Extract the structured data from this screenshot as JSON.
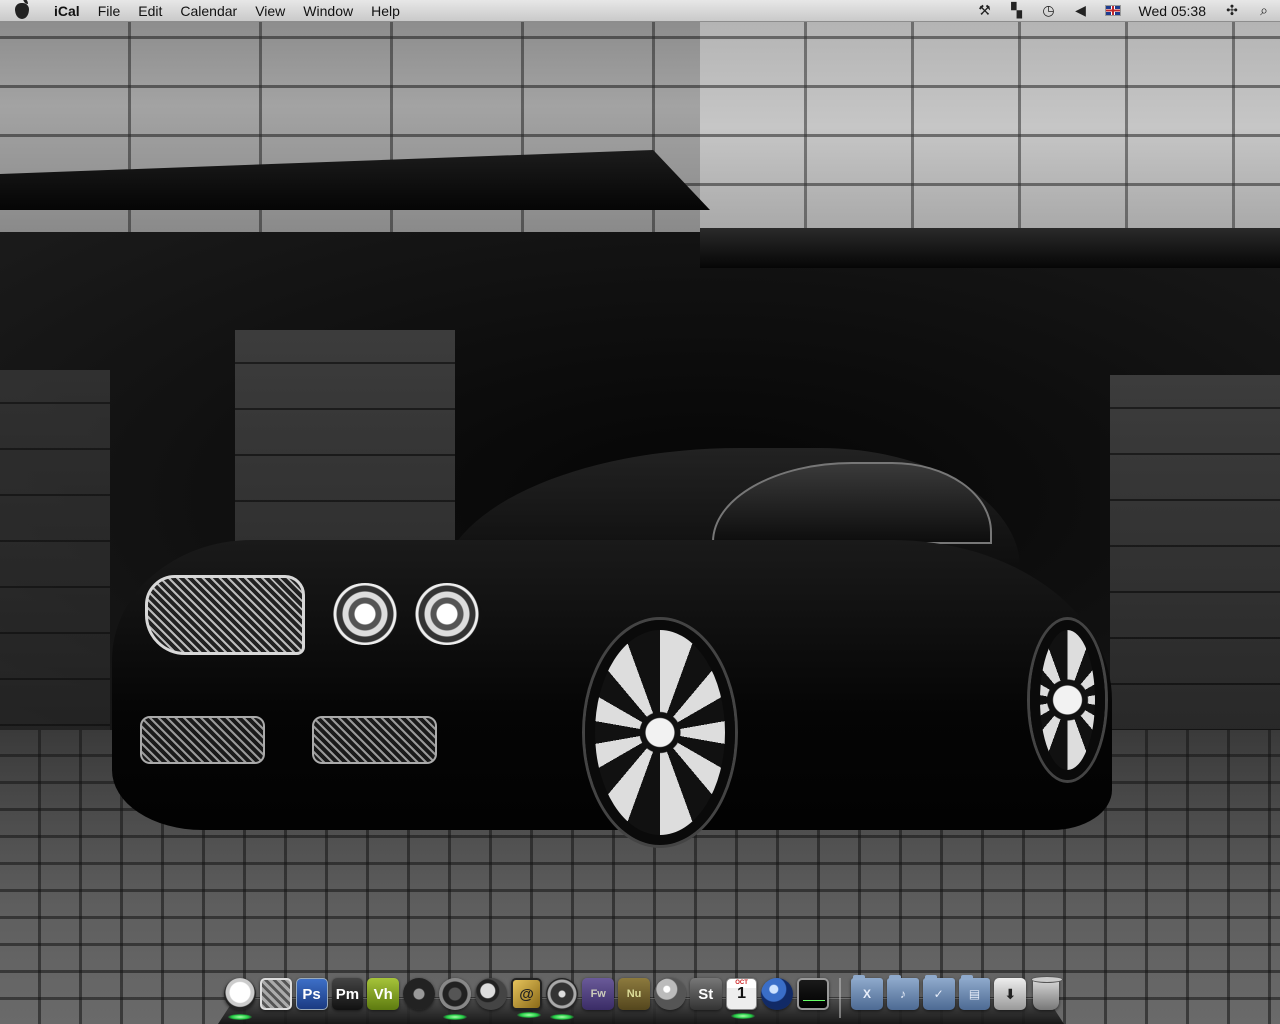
{
  "menubar": {
    "apple_icon": "apple-icon",
    "app_name": "iCal",
    "menus": [
      "File",
      "Edit",
      "Calendar",
      "View",
      "Window",
      "Help"
    ],
    "status_icons": [
      "tools-icon",
      "spaces-icon",
      "time-machine-icon",
      "volume-icon",
      "uk-flag-icon"
    ],
    "clock": "Wed 05:38",
    "spotlight_icon": "spotlight-icon"
  },
  "dock": {
    "apps": [
      {
        "name": "skull-icon",
        "label": ""
      },
      {
        "name": "system-preferences-icon",
        "label": ""
      },
      {
        "name": "photoshop-icon",
        "label": "Ps"
      },
      {
        "name": "pm-icon",
        "label": "Pm"
      },
      {
        "name": "vh-icon",
        "label": "Vh"
      },
      {
        "name": "camera-icon",
        "label": ""
      },
      {
        "name": "itunes-icon",
        "label": ""
      },
      {
        "name": "search-app-icon",
        "label": ""
      },
      {
        "name": "mail-icon",
        "label": "@"
      },
      {
        "name": "compass-icon",
        "label": ""
      },
      {
        "name": "fireworks-icon",
        "label": "Fw"
      },
      {
        "name": "nu-icon",
        "label": "Nu"
      },
      {
        "name": "globe-icon",
        "label": ""
      },
      {
        "name": "st-icon",
        "label": "St"
      },
      {
        "name": "ical-icon",
        "label": "1",
        "month": "OCT"
      },
      {
        "name": "quicktime-icon",
        "label": ""
      },
      {
        "name": "activity-monitor-icon",
        "label": ""
      }
    ],
    "stacks": [
      {
        "name": "applications-stack-icon",
        "label": "X"
      },
      {
        "name": "music-stack-icon",
        "label": "♪"
      },
      {
        "name": "utilities-stack-icon",
        "label": "✓"
      },
      {
        "name": "documents-stack-icon",
        "label": "▤"
      },
      {
        "name": "downloads-stack-icon",
        "label": "⬇"
      },
      {
        "name": "trash-icon",
        "label": ""
      }
    ]
  },
  "colors": {
    "menubar_bg": "#e8e8e8",
    "running_indicator": "#22cc44"
  }
}
